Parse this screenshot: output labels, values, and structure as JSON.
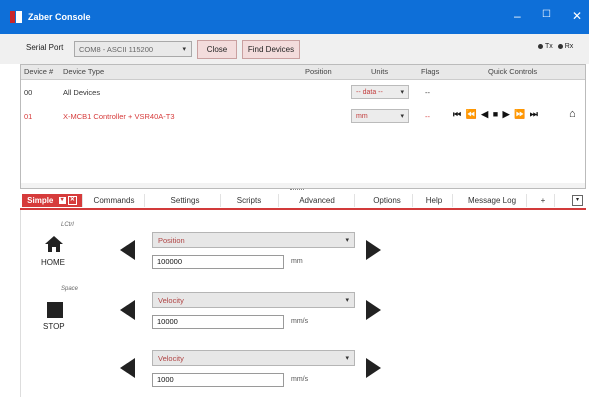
{
  "window": {
    "title": "Zaber Console",
    "controls": [
      "–",
      "☐",
      "✕"
    ]
  },
  "serial": {
    "label": "Serial Port",
    "port_value": "COM8 - ASCII 115200",
    "close_label": "Close",
    "find_label": "Find Devices",
    "tx_label": "Tx",
    "rx_label": "Rx"
  },
  "table": {
    "headers": [
      "Device #",
      "Device Type",
      "Position",
      "Units",
      "Flags",
      "Quick Controls"
    ],
    "rows": [
      {
        "num": "00",
        "type": "All Devices",
        "units": "-- data --",
        "flags": "--",
        "color": "#333333"
      },
      {
        "num": "01",
        "type": "X-MCB1 Controller + VSR40A-T3",
        "units": "mm",
        "flags": "--",
        "color": "#d63b3b"
      }
    ],
    "quick_controls_glyphs": "⏮ ⏪ ◀ ■ ▶ ⏩ ⏭",
    "home_glyph": "⌂"
  },
  "tabs": [
    {
      "label": "Simple",
      "active": true
    },
    {
      "label": "Commands"
    },
    {
      "label": "Settings"
    },
    {
      "label": "Scripts"
    },
    {
      "label": "Advanced"
    },
    {
      "label": "Options"
    },
    {
      "label": "Help"
    },
    {
      "label": "Message Log"
    },
    {
      "label": "+"
    }
  ],
  "simple": {
    "home": {
      "key": "LCtrl",
      "label": "HOME"
    },
    "stop": {
      "key": "Space",
      "label": "STOP"
    },
    "rows": [
      {
        "select": "Position",
        "value": "100000",
        "unit": "mm"
      },
      {
        "select": "Velocity",
        "value": "10000",
        "unit": "mm/s"
      },
      {
        "select": "Velocity",
        "value": "1000",
        "unit": "mm/s"
      }
    ]
  },
  "accent_color": "#d63b3b",
  "titlebar_color": "#0e6fd8"
}
